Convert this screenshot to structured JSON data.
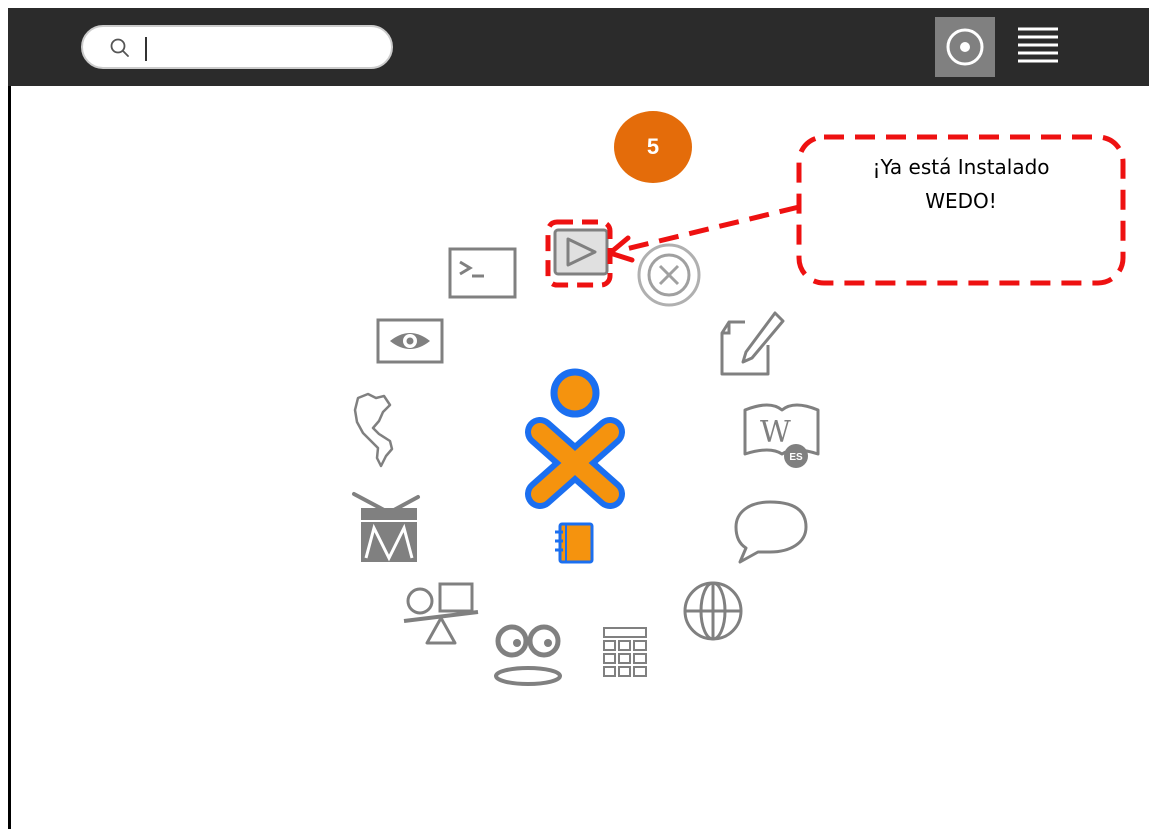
{
  "topbar": {
    "search": {
      "value": "",
      "placeholder": ""
    },
    "home_view_icon": "home-view-icon",
    "list_view_icon": "list-view-icon"
  },
  "home": {
    "center_icon": "xo-owner-icon",
    "journal_icon": "journal-icon",
    "activities": [
      "terminal-activity",
      "wedo-activity",
      "stop-activity",
      "write-activity",
      "wikipedia-es-activity",
      "chat-activity",
      "browse-activity",
      "calculate-activity",
      "speak-activity",
      "physics-activity",
      "tamtam-activity",
      "world-map-activity",
      "eye-activity"
    ],
    "wikipedia_badge": "ES"
  },
  "annotation": {
    "step_number": "5",
    "callout_line1": "¡Ya está Instalado",
    "callout_line2": "WEDO!",
    "highlight_color": "#ee1111",
    "badge_color": "#e46c0a"
  },
  "colors": {
    "topbar": "#2b2b2b",
    "icon_gray": "#808080",
    "xo_blue": "#1b6ff0",
    "xo_orange": "#f5930e"
  }
}
